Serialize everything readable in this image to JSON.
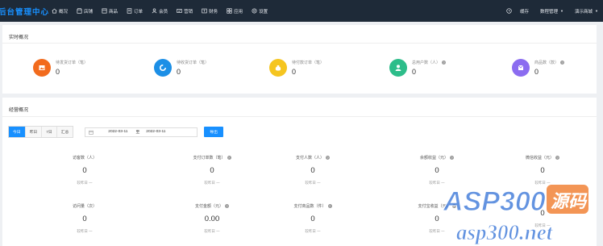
{
  "header": {
    "brand": "后台管理中心",
    "nav": [
      {
        "label": "概况",
        "icon": "home-icon"
      },
      {
        "label": "店铺",
        "icon": "store-icon"
      },
      {
        "label": "商品",
        "icon": "goods-icon"
      },
      {
        "label": "订单",
        "icon": "order-icon"
      },
      {
        "label": "会员",
        "icon": "member-icon"
      },
      {
        "label": "营销",
        "icon": "marketing-icon"
      },
      {
        "label": "财务",
        "icon": "finance-icon"
      },
      {
        "label": "应用",
        "icon": "apps-icon"
      },
      {
        "label": "设置",
        "icon": "settings-icon"
      }
    ],
    "right": {
      "cache": "缓存",
      "account": "数程管理",
      "mall": "演示商城"
    }
  },
  "realtime": {
    "title": "实时概况",
    "stats": [
      {
        "label": "待发货订单（笔）",
        "value": "0",
        "color": "#f26b1d",
        "icon": "image-icon",
        "help": false
      },
      {
        "label": "待收货订单（笔）",
        "value": "0",
        "color": "#1c8fe6",
        "icon": "refresh-icon",
        "help": false
      },
      {
        "label": "待付款订单（笔）",
        "value": "0",
        "color": "#f5c520",
        "icon": "money-bag-icon",
        "help": false
      },
      {
        "label": "总用户数（人）",
        "value": "0",
        "color": "#2dbd8a",
        "icon": "user-icon",
        "help": true
      },
      {
        "label": "商品数（款）",
        "value": "0",
        "color": "#8b6cf0",
        "icon": "box-icon",
        "help": true
      }
    ]
  },
  "business": {
    "title": "经营概况",
    "tabs": [
      "今日",
      "昨日",
      "7日",
      "汇总"
    ],
    "date_from": "2022-03-11",
    "date_sep": "至",
    "date_to": "2022-03-11",
    "export_label": "导出",
    "metrics": [
      {
        "label": "访客数（人）",
        "value": "0",
        "cmp": "较昨日 一",
        "help": false
      },
      {
        "label": "支付订单数（笔）",
        "value": "0",
        "cmp": "较昨日 一",
        "help": true
      },
      {
        "label": "支付人数（人）",
        "value": "0",
        "cmp": "较昨日 一",
        "help": true
      },
      {
        "label": "余额收益（元）",
        "value": "0",
        "cmp": "较昨日 一",
        "help": true
      },
      {
        "label": "微信收益（元）",
        "value": "0",
        "cmp": "较昨日 一",
        "help": true
      },
      {
        "label": "访问量（次）",
        "value": "0",
        "cmp": "较昨日 一",
        "help": false
      },
      {
        "label": "支付金额（元）",
        "value": "0.00",
        "cmp": "较昨日 一",
        "help": true
      },
      {
        "label": "支付商品数（件）",
        "value": "0",
        "cmp": "较昨日 一",
        "help": true
      },
      {
        "label": "支付宝收益（元）",
        "value": "0",
        "cmp": "较昨日 一",
        "help": true
      },
      {
        "label": "",
        "value": "0",
        "cmp": "较昨日 一",
        "help": false
      }
    ]
  },
  "watermark": {
    "top": "ASP300",
    "badge": "源码",
    "bottom": "asp300.net"
  }
}
